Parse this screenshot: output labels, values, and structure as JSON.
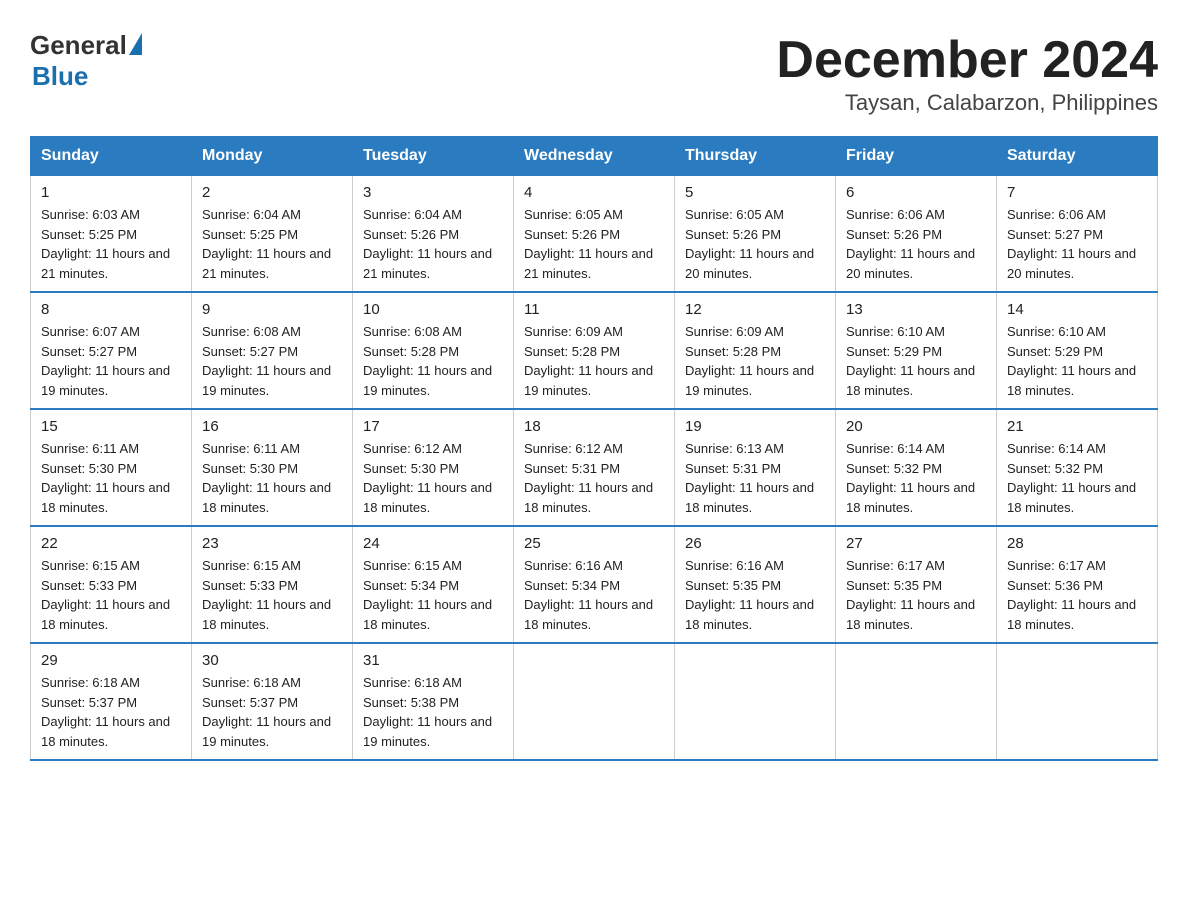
{
  "header": {
    "title": "December 2024",
    "subtitle": "Taysan, Calabarzon, Philippines"
  },
  "logo": {
    "general": "General",
    "blue": "Blue"
  },
  "weekdays": [
    "Sunday",
    "Monday",
    "Tuesday",
    "Wednesday",
    "Thursday",
    "Friday",
    "Saturday"
  ],
  "weeks": [
    [
      {
        "day": "1",
        "sunrise": "6:03 AM",
        "sunset": "5:25 PM",
        "daylight": "11 hours and 21 minutes."
      },
      {
        "day": "2",
        "sunrise": "6:04 AM",
        "sunset": "5:25 PM",
        "daylight": "11 hours and 21 minutes."
      },
      {
        "day": "3",
        "sunrise": "6:04 AM",
        "sunset": "5:26 PM",
        "daylight": "11 hours and 21 minutes."
      },
      {
        "day": "4",
        "sunrise": "6:05 AM",
        "sunset": "5:26 PM",
        "daylight": "11 hours and 21 minutes."
      },
      {
        "day": "5",
        "sunrise": "6:05 AM",
        "sunset": "5:26 PM",
        "daylight": "11 hours and 20 minutes."
      },
      {
        "day": "6",
        "sunrise": "6:06 AM",
        "sunset": "5:26 PM",
        "daylight": "11 hours and 20 minutes."
      },
      {
        "day": "7",
        "sunrise": "6:06 AM",
        "sunset": "5:27 PM",
        "daylight": "11 hours and 20 minutes."
      }
    ],
    [
      {
        "day": "8",
        "sunrise": "6:07 AM",
        "sunset": "5:27 PM",
        "daylight": "11 hours and 19 minutes."
      },
      {
        "day": "9",
        "sunrise": "6:08 AM",
        "sunset": "5:27 PM",
        "daylight": "11 hours and 19 minutes."
      },
      {
        "day": "10",
        "sunrise": "6:08 AM",
        "sunset": "5:28 PM",
        "daylight": "11 hours and 19 minutes."
      },
      {
        "day": "11",
        "sunrise": "6:09 AM",
        "sunset": "5:28 PM",
        "daylight": "11 hours and 19 minutes."
      },
      {
        "day": "12",
        "sunrise": "6:09 AM",
        "sunset": "5:28 PM",
        "daylight": "11 hours and 19 minutes."
      },
      {
        "day": "13",
        "sunrise": "6:10 AM",
        "sunset": "5:29 PM",
        "daylight": "11 hours and 18 minutes."
      },
      {
        "day": "14",
        "sunrise": "6:10 AM",
        "sunset": "5:29 PM",
        "daylight": "11 hours and 18 minutes."
      }
    ],
    [
      {
        "day": "15",
        "sunrise": "6:11 AM",
        "sunset": "5:30 PM",
        "daylight": "11 hours and 18 minutes."
      },
      {
        "day": "16",
        "sunrise": "6:11 AM",
        "sunset": "5:30 PM",
        "daylight": "11 hours and 18 minutes."
      },
      {
        "day": "17",
        "sunrise": "6:12 AM",
        "sunset": "5:30 PM",
        "daylight": "11 hours and 18 minutes."
      },
      {
        "day": "18",
        "sunrise": "6:12 AM",
        "sunset": "5:31 PM",
        "daylight": "11 hours and 18 minutes."
      },
      {
        "day": "19",
        "sunrise": "6:13 AM",
        "sunset": "5:31 PM",
        "daylight": "11 hours and 18 minutes."
      },
      {
        "day": "20",
        "sunrise": "6:14 AM",
        "sunset": "5:32 PM",
        "daylight": "11 hours and 18 minutes."
      },
      {
        "day": "21",
        "sunrise": "6:14 AM",
        "sunset": "5:32 PM",
        "daylight": "11 hours and 18 minutes."
      }
    ],
    [
      {
        "day": "22",
        "sunrise": "6:15 AM",
        "sunset": "5:33 PM",
        "daylight": "11 hours and 18 minutes."
      },
      {
        "day": "23",
        "sunrise": "6:15 AM",
        "sunset": "5:33 PM",
        "daylight": "11 hours and 18 minutes."
      },
      {
        "day": "24",
        "sunrise": "6:15 AM",
        "sunset": "5:34 PM",
        "daylight": "11 hours and 18 minutes."
      },
      {
        "day": "25",
        "sunrise": "6:16 AM",
        "sunset": "5:34 PM",
        "daylight": "11 hours and 18 minutes."
      },
      {
        "day": "26",
        "sunrise": "6:16 AM",
        "sunset": "5:35 PM",
        "daylight": "11 hours and 18 minutes."
      },
      {
        "day": "27",
        "sunrise": "6:17 AM",
        "sunset": "5:35 PM",
        "daylight": "11 hours and 18 minutes."
      },
      {
        "day": "28",
        "sunrise": "6:17 AM",
        "sunset": "5:36 PM",
        "daylight": "11 hours and 18 minutes."
      }
    ],
    [
      {
        "day": "29",
        "sunrise": "6:18 AM",
        "sunset": "5:37 PM",
        "daylight": "11 hours and 18 minutes."
      },
      {
        "day": "30",
        "sunrise": "6:18 AM",
        "sunset": "5:37 PM",
        "daylight": "11 hours and 19 minutes."
      },
      {
        "day": "31",
        "sunrise": "6:18 AM",
        "sunset": "5:38 PM",
        "daylight": "11 hours and 19 minutes."
      },
      null,
      null,
      null,
      null
    ]
  ]
}
